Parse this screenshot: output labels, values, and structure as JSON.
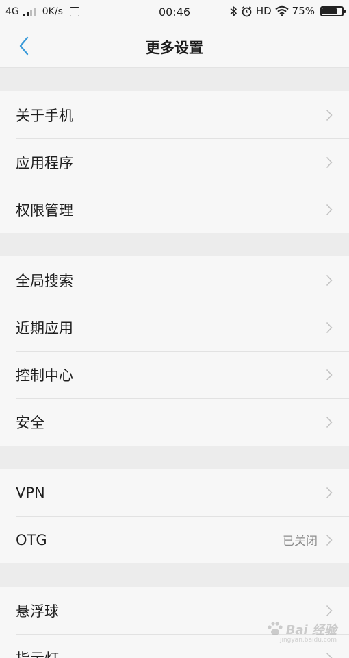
{
  "status_bar": {
    "network": "4G",
    "speed": "0K/s",
    "time": "00:46",
    "hd": "HD",
    "battery": "75%",
    "battery_level": 0.75
  },
  "header": {
    "title": "更多设置",
    "back_icon": "chevron-left-icon"
  },
  "accent_color": "#3a9ad9",
  "groups": [
    {
      "items": [
        {
          "label": "关于手机"
        },
        {
          "label": "应用程序"
        },
        {
          "label": "权限管理"
        }
      ]
    },
    {
      "items": [
        {
          "label": "全局搜索"
        },
        {
          "label": "近期应用"
        },
        {
          "label": "控制中心"
        },
        {
          "label": "安全"
        }
      ]
    },
    {
      "items": [
        {
          "label": "VPN"
        },
        {
          "label": "OTG",
          "value": "已关闭"
        }
      ]
    },
    {
      "items": [
        {
          "label": "悬浮球"
        },
        {
          "label": "指示灯"
        }
      ]
    }
  ],
  "watermark": {
    "text": "Bai 经验",
    "url": "jingyan.baidu.com"
  }
}
